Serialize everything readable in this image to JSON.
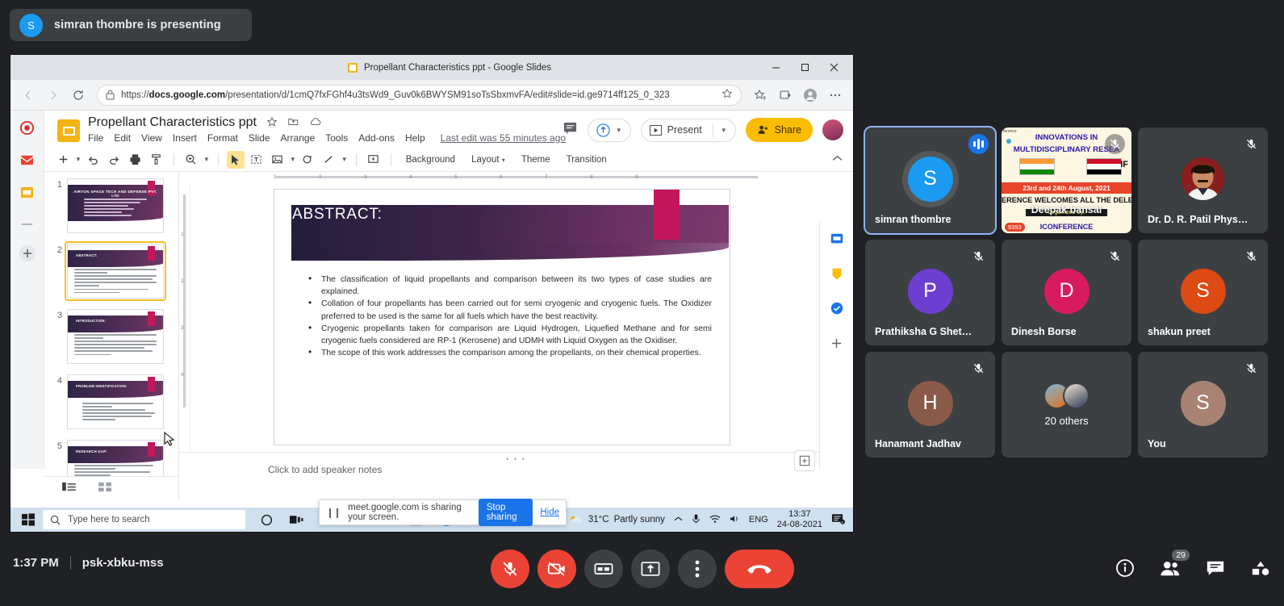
{
  "banner": {
    "initial": "S",
    "text": "simran thombre is presenting"
  },
  "browser": {
    "window_title": "Propellant Characteristics ppt - Google Slides",
    "url_prefix": "https://",
    "url_domain": "docs.google.com",
    "url_path": "/presentation/d/1cmQ7fxFGhf4u3tsWd9_Guv0k6BWYSM91soTsSbxmvFA/edit#slide=id.ge9714ff125_0_323",
    "controls": {
      "minimize": "minimize-button",
      "maximize": "maximize-button",
      "close": "close-button"
    }
  },
  "slides": {
    "doc_title": "Propellant Characteristics ppt",
    "menu": [
      "File",
      "Edit",
      "View",
      "Insert",
      "Format",
      "Slide",
      "Arrange",
      "Tools",
      "Add-ons",
      "Help"
    ],
    "last_edit": "Last edit was 55 minutes ago",
    "present_label": "Present",
    "share_label": "Share",
    "toolbar_text": [
      "Background",
      "Layout",
      "Theme",
      "Transition"
    ],
    "notes_placeholder": "Click to add speaker notes",
    "thumbnails": [
      {
        "num": "1",
        "title": "AIRYON SPACE TECH AND DEFENSE PVT. LTD",
        "subtitle": "Research paper on Comparative study of Propellant Characteristics for Reusable Launch Vehicle"
      },
      {
        "num": "2",
        "title": "ABSTRACT:"
      },
      {
        "num": "3",
        "title": "INTRODUCTION:"
      },
      {
        "num": "4",
        "title": "PROBLEM IDENTIFICATION:"
      },
      {
        "num": "5",
        "title": "RESEARCH GAP:"
      }
    ],
    "active_thumb_index": 1,
    "slide": {
      "title": "ABSTRACT:",
      "bullets": [
        "The classification of liquid propellants and comparison between its two types of case studies are explained.",
        " Collation of four propellants has been carried out for semi cryogenic and cryogenic fuels. The Oxidizer preferred to be used is the same for all fuels which have the best reactivity.",
        "Cryogenic propellants taken for comparison are Liquid Hydrogen, Liquefied Methane and for semi cryogenic fuels considered are RP-1 (Kerosene) and UDMH with Liquid Oxygen as the Oxidiser.",
        "The scope of this work addresses the comparison among the propellants, on their chemical properties."
      ]
    },
    "ruler_ticks": [
      "1",
      "2",
      "3",
      "4",
      "5",
      "6",
      "7",
      "8",
      "9"
    ],
    "ruler_ticks_v": [
      "1",
      "2",
      "3",
      "4"
    ]
  },
  "share_infobar": {
    "message": "meet.google.com is sharing your screen.",
    "stop_label": "Stop sharing",
    "hide_label": "Hide"
  },
  "taskbar": {
    "search_placeholder": "Type here to search",
    "weather_temp": "31°C",
    "weather_desc": "Partly sunny",
    "language": "ENG",
    "time": "13:37",
    "date": "24-08-2021",
    "apps": [
      "cortana-icon",
      "task-view-icon",
      "word-icon",
      "powerpoint-icon",
      "file-explorer-icon",
      "adobe-reader-icon",
      "edge-icon",
      "excel-icon",
      "outlook-icon"
    ]
  },
  "meet": {
    "tiles": [
      {
        "name": "simran thombre",
        "initial": "S",
        "color": "#1a9bf0",
        "type": "avatar",
        "speaking": true,
        "active": true,
        "muted": false
      },
      {
        "name": "Deepak bansal",
        "type": "poster",
        "muted": true,
        "poster": {
          "line1": "INNOVATIONS IN",
          "line2": "MULTIDISCIPLINARY RESEA",
          "dates": "23rd and 24th August, 2021",
          "welcome": "ERENCE WELCOMES ALL THE DELE",
          "organized": "Organized by:",
          "brand": "ICONFERENCE",
          "phone": "9393",
          "ifl": "IF",
          "corner": "ference"
        }
      },
      {
        "name": "Dr. D. R. Patil Phys…",
        "type": "photo",
        "color": "#8b1f1f",
        "muted": true
      },
      {
        "name": "Prathiksha G Shet…",
        "initial": "P",
        "color": "#6c3fd1",
        "type": "avatar",
        "muted": true
      },
      {
        "name": "Dinesh Borse",
        "initial": "D",
        "color": "#d81b60",
        "type": "avatar",
        "muted": true
      },
      {
        "name": "shakun preet",
        "initial": "S",
        "color": "#dd4a13",
        "type": "avatar",
        "muted": true
      },
      {
        "name": "Hanamant Jadhav",
        "initial": "H",
        "color": "#8a5a49",
        "type": "avatar",
        "muted": true
      },
      {
        "name": "20 others",
        "type": "others",
        "muted": false
      },
      {
        "name": "You",
        "initial": "S",
        "color": "#a98274",
        "type": "avatar",
        "muted": true
      }
    ],
    "bottom": {
      "time": "1:37 PM",
      "meeting_code": "psk-xbku-mss",
      "controls": [
        "microphone-off-button",
        "camera-off-button",
        "captions-button",
        "present-now-button",
        "more-options-button",
        "leave-call-button"
      ],
      "right_icons": [
        "meeting-details-icon",
        "people-icon",
        "chat-icon",
        "activities-icon"
      ],
      "participant_count": "29"
    }
  }
}
